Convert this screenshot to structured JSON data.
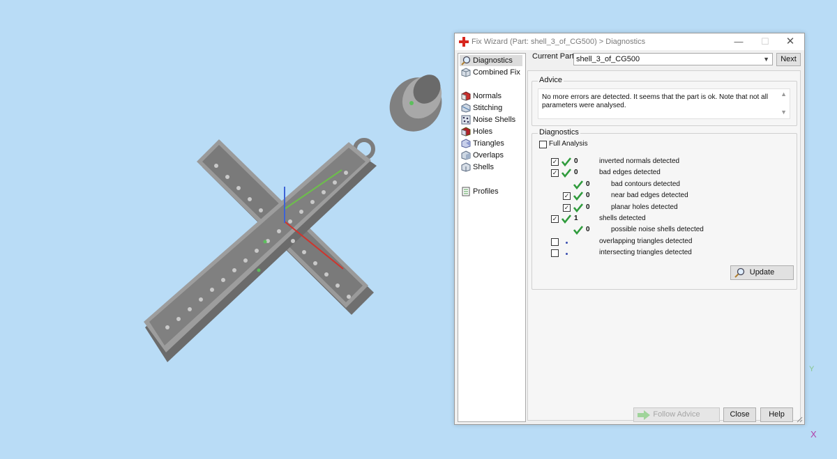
{
  "window": {
    "title": "Fix Wizard (Part: shell_3_of_CG500) > Diagnostics",
    "minimize": "—",
    "maximize": "☐",
    "close": "✕"
  },
  "nav": {
    "items": [
      {
        "label": "Diagnostics",
        "icon": "magnifier-icon",
        "selected": true
      },
      {
        "label": "Combined Fix",
        "icon": "cube-icon"
      },
      {
        "label": "Normals",
        "icon": "normals-cube-icon"
      },
      {
        "label": "Stitching",
        "icon": "stitching-cube-icon"
      },
      {
        "label": "Noise Shells",
        "icon": "noise-shells-icon"
      },
      {
        "label": "Holes",
        "icon": "holes-cube-icon"
      },
      {
        "label": "Triangles",
        "icon": "triangles-icon"
      },
      {
        "label": "Overlaps",
        "icon": "overlaps-cube-icon"
      },
      {
        "label": "Shells",
        "icon": "shells-cube-icon"
      },
      {
        "label": "Profiles",
        "icon": "document-icon"
      }
    ]
  },
  "current_part": {
    "label": "Current Part:",
    "value": "shell_3_of_CG500",
    "next": "Next"
  },
  "advice": {
    "title": "Advice",
    "text": "No more errors are detected. It seems that the part is ok. Note that not all parameters were analysed."
  },
  "diagnostics": {
    "title": "Diagnostics",
    "full_analysis": "Full Analysis",
    "rows": [
      {
        "checked": true,
        "count": "0",
        "label": "inverted normals detected",
        "ok": true
      },
      {
        "checked": true,
        "count": "0",
        "label": "bad edges detected",
        "ok": true
      },
      {
        "count": "0",
        "label": "bad contours detected",
        "ok": true
      },
      {
        "checked": true,
        "count": "0",
        "label": "near bad edges detected",
        "ok": true
      },
      {
        "checked": true,
        "count": "0",
        "label": "planar holes detected",
        "ok": true
      },
      {
        "checked": true,
        "count": "1",
        "label": "shells detected",
        "ok": true
      },
      {
        "count": "0",
        "label": "possible noise shells detected",
        "ok": true
      },
      {
        "checked": false,
        "label": "overlapping triangles detected",
        "ok": false
      },
      {
        "checked": false,
        "label": "intersecting triangles detected",
        "ok": false
      }
    ],
    "update": "Update"
  },
  "footer": {
    "follow_advice": "Follow Advice",
    "close": "Close",
    "help": "Help"
  },
  "viewport": {
    "axis_y": "Y",
    "axis_x": "X"
  },
  "colors": {
    "background": "#b9dcf6",
    "tick_green": "#2f9b3c",
    "model_gray": "#8a8a8a"
  }
}
